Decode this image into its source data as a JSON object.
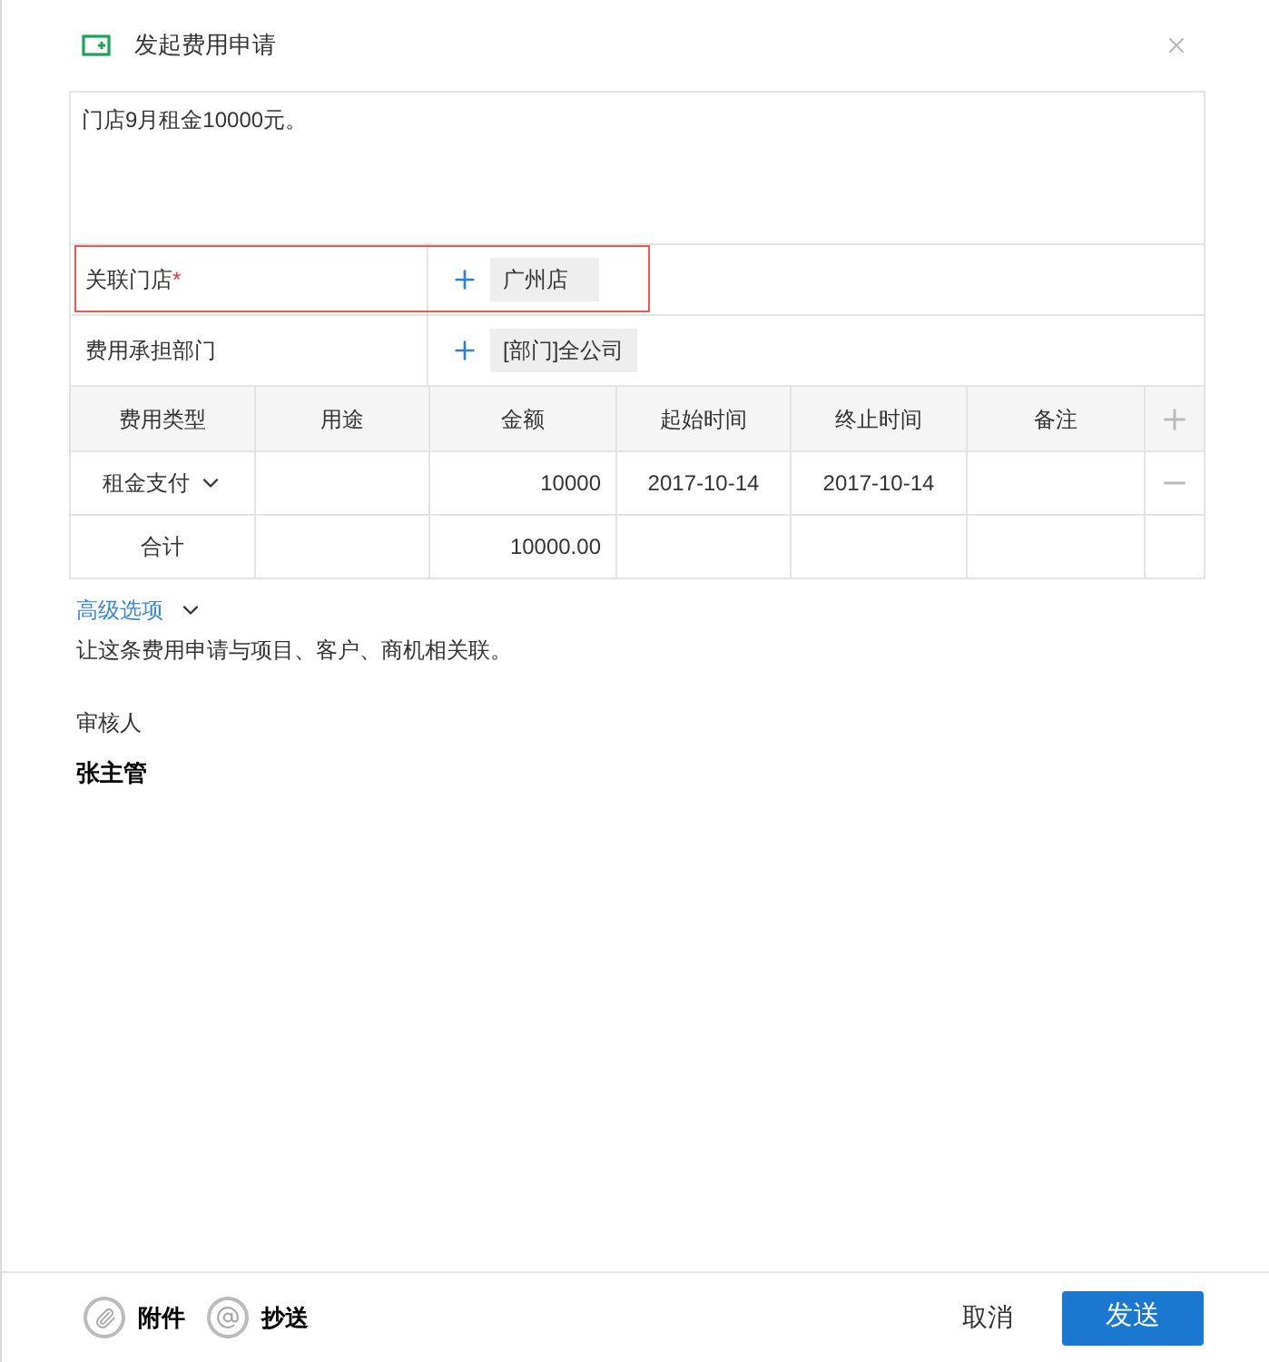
{
  "dialog": {
    "title": "发起费用申请"
  },
  "description": {
    "value": "门店9月租金10000元。"
  },
  "fields": [
    {
      "label": "关联门店",
      "required_mark": "*",
      "highlighted": true,
      "value": "广州店"
    },
    {
      "label": "费用承担部门",
      "highlighted": false,
      "value": "[部门]全公司"
    }
  ],
  "table": {
    "columns": [
      "费用类型",
      "用途",
      "金额",
      "起始时间",
      "终止时间",
      "备注"
    ],
    "rows": [
      {
        "kind": "item",
        "cells": [
          "租金支付",
          "",
          "10000",
          "2017-10-14",
          "2017-10-14",
          ""
        ]
      },
      {
        "kind": "total",
        "cells": [
          "合计",
          "",
          "10000.00",
          "",
          "",
          ""
        ]
      }
    ]
  },
  "advanced": {
    "label": "高级选项",
    "expanded": false,
    "hint": "让这条费用申请与项目、客户、商机相关联。"
  },
  "approver": {
    "label": "审核人",
    "name": "张主管"
  },
  "footer": {
    "attachments": "附件",
    "cc": "抄送",
    "cancel": "取消",
    "submit": "发送"
  }
}
